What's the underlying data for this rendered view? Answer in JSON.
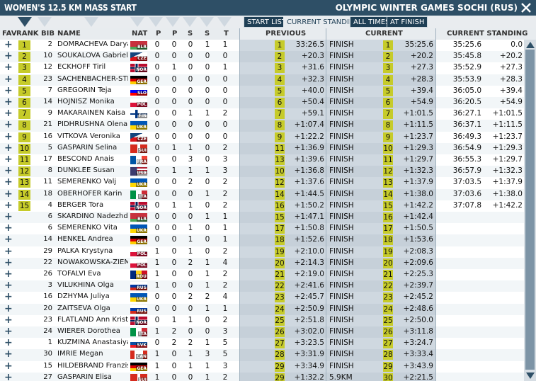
{
  "title": {
    "event": "WOMEN'S 12.5 KM MASS START",
    "games": "OLYMPIC WINTER GAMES SOCHI (RUS)"
  },
  "toolbar": {
    "start_list": "START LIST",
    "current_standing": "CURRENT STANDING",
    "all_times": "ALL TIMES",
    "at_finish": "AT FINISH"
  },
  "headers": {
    "fav": "FAV",
    "rank": "RANK",
    "bib": "BIB",
    "name": "NAME",
    "nat": "NAT",
    "p1": "P",
    "p2": "P",
    "s1": "S",
    "s2": "S",
    "t": "T",
    "previous": "PREVIOUS",
    "current": "CURRENT",
    "current_standing": "CURRENT STANDING"
  },
  "accent": "#c6cb2a",
  "athletes": [
    {
      "rank": "1",
      "bib": "2",
      "name": "DOMRACHEVA Darya",
      "nat": "BLR",
      "pen": [
        "0",
        "0",
        "0",
        "1",
        "1"
      ],
      "prev_rank": "1",
      "prev_time": "33:26.5",
      "status": "FINISH",
      "cur_rank": "1",
      "cur_time": "35:25.6",
      "stand_time": "35:25.6",
      "stand_diff": "0.0"
    },
    {
      "rank": "2",
      "bib": "10",
      "name": "SOUKALOVA Gabriela",
      "nat": "CZE",
      "pen": [
        "0",
        "0",
        "0",
        "0",
        "0"
      ],
      "prev_rank": "2",
      "prev_time": "+20.3",
      "status": "FINISH",
      "cur_rank": "2",
      "cur_time": "+20.2",
      "stand_time": "35:45.8",
      "stand_diff": "+20.2"
    },
    {
      "rank": "3",
      "bib": "12",
      "name": "ECKHOFF Tiril",
      "nat": "NOR",
      "pen": [
        "0",
        "1",
        "0",
        "0",
        "1"
      ],
      "prev_rank": "3",
      "prev_time": "+31.6",
      "status": "FINISH",
      "cur_rank": "3",
      "cur_time": "+27.3",
      "stand_time": "35:52.9",
      "stand_diff": "+27.3"
    },
    {
      "rank": "4",
      "bib": "23",
      "name": "SACHENBACHER-STEHLE",
      "nat": "GER",
      "pen": [
        "0",
        "0",
        "0",
        "0",
        "0"
      ],
      "prev_rank": "4",
      "prev_time": "+32.3",
      "status": "FINISH",
      "cur_rank": "4",
      "cur_time": "+28.3",
      "stand_time": "35:53.9",
      "stand_diff": "+28.3"
    },
    {
      "rank": "5",
      "bib": "7",
      "name": "GREGORIN Teja",
      "nat": "SLO",
      "pen": [
        "0",
        "0",
        "0",
        "0",
        "0"
      ],
      "prev_rank": "5",
      "prev_time": "+40.0",
      "status": "FINISH",
      "cur_rank": "5",
      "cur_time": "+39.4",
      "stand_time": "36:05.0",
      "stand_diff": "+39.4"
    },
    {
      "rank": "6",
      "bib": "14",
      "name": "HOJNISZ Monika",
      "nat": "POL",
      "pen": [
        "0",
        "0",
        "0",
        "0",
        "0"
      ],
      "prev_rank": "6",
      "prev_time": "+50.4",
      "status": "FINISH",
      "cur_rank": "6",
      "cur_time": "+54.9",
      "stand_time": "36:20.5",
      "stand_diff": "+54.9"
    },
    {
      "rank": "7",
      "bib": "9",
      "name": "MAKARAINEN Kaisa",
      "nat": "FIN",
      "pen": [
        "0",
        "0",
        "1",
        "1",
        "2"
      ],
      "prev_rank": "7",
      "prev_time": "+59.1",
      "status": "FINISH",
      "cur_rank": "7",
      "cur_time": "+1:01.5",
      "stand_time": "36:27.1",
      "stand_diff": "+1:01.5"
    },
    {
      "rank": "8",
      "bib": "21",
      "name": "PIDHRUSHNA Olena",
      "nat": "UKR",
      "pen": [
        "0",
        "0",
        "0",
        "0",
        "0"
      ],
      "prev_rank": "8",
      "prev_time": "+1:07.4",
      "status": "FINISH",
      "cur_rank": "8",
      "cur_time": "+1:11.5",
      "stand_time": "36:37.1",
      "stand_diff": "+1:11.5"
    },
    {
      "rank": "9",
      "bib": "16",
      "name": "VITKOVA Veronika",
      "nat": "CZE",
      "pen": [
        "0",
        "0",
        "0",
        "0",
        "0"
      ],
      "prev_rank": "9",
      "prev_time": "+1:22.2",
      "status": "FINISH",
      "cur_rank": "9",
      "cur_time": "+1:23.7",
      "stand_time": "36:49.3",
      "stand_diff": "+1:23.7"
    },
    {
      "rank": "10",
      "bib": "5",
      "name": "GASPARIN Selina",
      "nat": "SUI",
      "pen": [
        "0",
        "1",
        "1",
        "0",
        "2"
      ],
      "prev_rank": "11",
      "prev_time": "+1:36.9",
      "status": "FINISH",
      "cur_rank": "10",
      "cur_time": "+1:29.3",
      "stand_time": "36:54.9",
      "stand_diff": "+1:29.3"
    },
    {
      "rank": "11",
      "bib": "17",
      "name": "BESCOND Anais",
      "nat": "FRA",
      "pen": [
        "0",
        "0",
        "3",
        "0",
        "3"
      ],
      "prev_rank": "13",
      "prev_time": "+1:39.6",
      "status": "FINISH",
      "cur_rank": "11",
      "cur_time": "+1:29.7",
      "stand_time": "36:55.3",
      "stand_diff": "+1:29.7"
    },
    {
      "rank": "12",
      "bib": "8",
      "name": "DUNKLEE Susan",
      "nat": "USA",
      "pen": [
        "0",
        "1",
        "1",
        "1",
        "3"
      ],
      "prev_rank": "10",
      "prev_time": "+1:36.8",
      "status": "FINISH",
      "cur_rank": "12",
      "cur_time": "+1:32.3",
      "stand_time": "36:57.9",
      "stand_diff": "+1:32.3"
    },
    {
      "rank": "13",
      "bib": "11",
      "name": "SEMERENKO Valj",
      "nat": "UKR",
      "pen": [
        "0",
        "0",
        "2",
        "0",
        "2"
      ],
      "prev_rank": "12",
      "prev_time": "+1:37.6",
      "status": "FINISH",
      "cur_rank": "13",
      "cur_time": "+1:37.9",
      "stand_time": "37:03.5",
      "stand_diff": "+1:37.9"
    },
    {
      "rank": "14",
      "bib": "18",
      "name": "OBERHOFER Karin",
      "nat": "ITA",
      "pen": [
        "0",
        "0",
        "0",
        "1",
        "2"
      ],
      "prev_rank": "14",
      "prev_time": "+1:44.5",
      "status": "FINISH",
      "cur_rank": "14",
      "cur_time": "+1:38.0",
      "stand_time": "37:03.6",
      "stand_diff": "+1:38.0"
    },
    {
      "rank": "15",
      "bib": "4",
      "name": "BERGER Tora",
      "nat": "NOR",
      "pen": [
        "0",
        "1",
        "1",
        "0",
        "2"
      ],
      "prev_rank": "16",
      "prev_time": "+1:50.2",
      "status": "FINISH",
      "cur_rank": "15",
      "cur_time": "+1:42.2",
      "stand_time": "37:07.8",
      "stand_diff": "+1:42.2"
    },
    {
      "rank": "",
      "bib": "6",
      "name": "SKARDINO Nadezhda",
      "nat": "BLR",
      "pen": [
        "0",
        "0",
        "0",
        "1",
        "1"
      ],
      "prev_rank": "15",
      "prev_time": "+1:47.1",
      "status": "FINISH",
      "cur_rank": "16",
      "cur_time": "+1:42.4",
      "stand_time": "",
      "stand_diff": ""
    },
    {
      "rank": "",
      "bib": "6",
      "name": "SEMERENKO Vita",
      "nat": "UKR",
      "pen": [
        "0",
        "0",
        "1",
        "0",
        "1"
      ],
      "prev_rank": "17",
      "prev_time": "+1:50.8",
      "status": "FINISH",
      "cur_rank": "17",
      "cur_time": "+1:50.5",
      "stand_time": "",
      "stand_diff": ""
    },
    {
      "rank": "",
      "bib": "14",
      "name": "HENKEL Andrea",
      "nat": "GER",
      "pen": [
        "0",
        "0",
        "1",
        "0",
        "1"
      ],
      "prev_rank": "18",
      "prev_time": "+1:52.6",
      "status": "FINISH",
      "cur_rank": "18",
      "cur_time": "+1:53.6",
      "stand_time": "",
      "stand_diff": ""
    },
    {
      "rank": "",
      "bib": "29",
      "name": "PALKA Krystyna",
      "nat": "POL",
      "pen": [
        "1",
        "0",
        "1",
        "0",
        "2"
      ],
      "prev_rank": "19",
      "prev_time": "+2:10.0",
      "status": "FINISH",
      "cur_rank": "19",
      "cur_time": "+2:08.3",
      "stand_time": "",
      "stand_diff": ""
    },
    {
      "rank": "",
      "bib": "22",
      "name": "NOWAKOWSKA-ZIEMNIAK",
      "nat": "POL",
      "pen": [
        "1",
        "0",
        "2",
        "1",
        "4"
      ],
      "prev_rank": "20",
      "prev_time": "+2:14.3",
      "status": "FINISH",
      "cur_rank": "20",
      "cur_time": "+2:09.6",
      "stand_time": "",
      "stand_diff": ""
    },
    {
      "rank": "",
      "bib": "26",
      "name": "TOFALVI Eva",
      "nat": "ROU",
      "pen": [
        "1",
        "0",
        "0",
        "1",
        "2"
      ],
      "prev_rank": "21",
      "prev_time": "+2:19.0",
      "status": "FINISH",
      "cur_rank": "21",
      "cur_time": "+2:25.3",
      "stand_time": "",
      "stand_diff": ""
    },
    {
      "rank": "",
      "bib": "3",
      "name": "VILUKHINA Olga",
      "nat": "RUS",
      "pen": [
        "1",
        "0",
        "0",
        "1",
        "2"
      ],
      "prev_rank": "22",
      "prev_time": "+2:41.6",
      "status": "FINISH",
      "cur_rank": "22",
      "cur_time": "+2:39.7",
      "stand_time": "",
      "stand_diff": ""
    },
    {
      "rank": "",
      "bib": "16",
      "name": "DZHYMA Juliya",
      "nat": "UKR",
      "pen": [
        "0",
        "0",
        "2",
        "2",
        "4"
      ],
      "prev_rank": "23",
      "prev_time": "+2:45.7",
      "status": "FINISH",
      "cur_rank": "23",
      "cur_time": "+2:45.2",
      "stand_time": "",
      "stand_diff": ""
    },
    {
      "rank": "",
      "bib": "20",
      "name": "ZAITSEVA Olga",
      "nat": "RUS",
      "pen": [
        "0",
        "0",
        "0",
        "1",
        "1"
      ],
      "prev_rank": "24",
      "prev_time": "+2:50.9",
      "status": "FINISH",
      "cur_rank": "24",
      "cur_time": "+2:48.6",
      "stand_time": "",
      "stand_diff": ""
    },
    {
      "rank": "",
      "bib": "23",
      "name": "FLATLAND Ann Kristin",
      "nat": "NOR",
      "pen": [
        "0",
        "1",
        "1",
        "0",
        "2"
      ],
      "prev_rank": "25",
      "prev_time": "+2:51.8",
      "status": "FINISH",
      "cur_rank": "25",
      "cur_time": "+2:50.0",
      "stand_time": "",
      "stand_diff": ""
    },
    {
      "rank": "",
      "bib": "24",
      "name": "WIERER Dorothea",
      "nat": "ITA",
      "pen": [
        "1",
        "2",
        "0",
        "0",
        "3"
      ],
      "prev_rank": "26",
      "prev_time": "+3:02.0",
      "status": "FINISH",
      "cur_rank": "26",
      "cur_time": "+3:11.8",
      "stand_time": "",
      "stand_diff": ""
    },
    {
      "rank": "",
      "bib": "1",
      "name": "KUZMINA Anastasiya",
      "nat": "SVK",
      "pen": [
        "0",
        "2",
        "2",
        "1",
        "5"
      ],
      "prev_rank": "27",
      "prev_time": "+3:23.5",
      "status": "FINISH",
      "cur_rank": "27",
      "cur_time": "+3:24.7",
      "stand_time": "",
      "stand_diff": ""
    },
    {
      "rank": "",
      "bib": "30",
      "name": "IMRIE Megan",
      "nat": "CAN",
      "pen": [
        "1",
        "0",
        "1",
        "3",
        "5"
      ],
      "prev_rank": "28",
      "prev_time": "+3:31.9",
      "status": "FINISH",
      "cur_rank": "28",
      "cur_time": "+3:33.4",
      "stand_time": "",
      "stand_diff": ""
    },
    {
      "rank": "",
      "bib": "15",
      "name": "HILDEBRAND Franziska",
      "nat": "GER",
      "pen": [
        "1",
        "0",
        "1",
        "1",
        "3"
      ],
      "prev_rank": "29",
      "prev_time": "+3:34.9",
      "status": "FINISH",
      "cur_rank": "29",
      "cur_time": "+3:43.9",
      "stand_time": "",
      "stand_diff": ""
    },
    {
      "rank": "",
      "bib": "27",
      "name": "GASPARIN Elisa",
      "nat": "SUI",
      "pen": [
        "1",
        "0",
        "0",
        "1",
        "2"
      ],
      "prev_rank": "29",
      "prev_time": "+1:32.2",
      "status": "5.9KM",
      "cur_rank": "30",
      "cur_time": "+2:21.5",
      "stand_time": "",
      "stand_diff": ""
    }
  ]
}
